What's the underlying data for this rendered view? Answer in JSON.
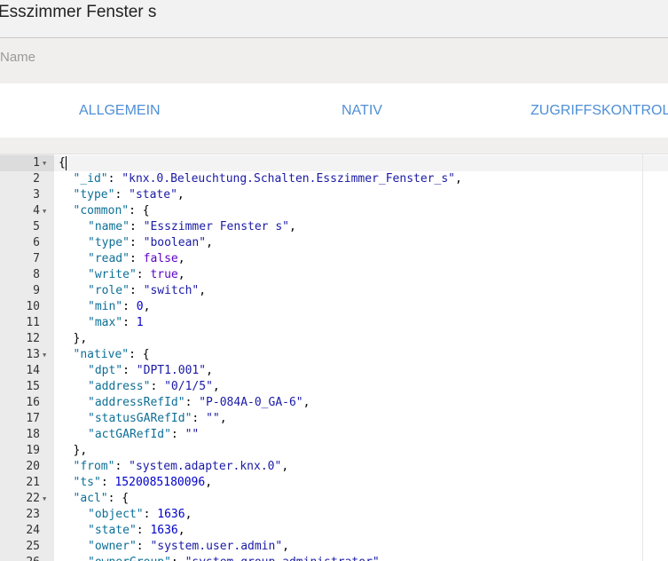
{
  "object_title": "Esszimmer Fenster s",
  "name_label": "Name",
  "tabs": [
    "ALLGEMEIN",
    "NATIV",
    "ZUGRIFFSKONTROLLE"
  ],
  "editor": {
    "lines": [
      {
        "no": "1",
        "fold": true,
        "indent": 0,
        "tokens": [
          [
            "p",
            "{"
          ]
        ]
      },
      {
        "no": "2",
        "fold": false,
        "indent": 1,
        "tokens": [
          [
            "k",
            "\"_id\""
          ],
          [
            "p",
            ": "
          ],
          [
            "s",
            "\"knx.0.Beleuchtung.Schalten.Esszimmer_Fenster_s\""
          ],
          [
            "p",
            ","
          ]
        ]
      },
      {
        "no": "3",
        "fold": false,
        "indent": 1,
        "tokens": [
          [
            "k",
            "\"type\""
          ],
          [
            "p",
            ": "
          ],
          [
            "s",
            "\"state\""
          ],
          [
            "p",
            ","
          ]
        ]
      },
      {
        "no": "4",
        "fold": true,
        "indent": 1,
        "tokens": [
          [
            "k",
            "\"common\""
          ],
          [
            "p",
            ": {"
          ]
        ]
      },
      {
        "no": "5",
        "fold": false,
        "indent": 2,
        "tokens": [
          [
            "k",
            "\"name\""
          ],
          [
            "p",
            ": "
          ],
          [
            "s",
            "\"Esszimmer Fenster s\""
          ],
          [
            "p",
            ","
          ]
        ]
      },
      {
        "no": "6",
        "fold": false,
        "indent": 2,
        "tokens": [
          [
            "k",
            "\"type\""
          ],
          [
            "p",
            ": "
          ],
          [
            "s",
            "\"boolean\""
          ],
          [
            "p",
            ","
          ]
        ]
      },
      {
        "no": "7",
        "fold": false,
        "indent": 2,
        "tokens": [
          [
            "k",
            "\"read\""
          ],
          [
            "p",
            ": "
          ],
          [
            "b",
            "false"
          ],
          [
            "p",
            ","
          ]
        ]
      },
      {
        "no": "8",
        "fold": false,
        "indent": 2,
        "tokens": [
          [
            "k",
            "\"write\""
          ],
          [
            "p",
            ": "
          ],
          [
            "b",
            "true"
          ],
          [
            "p",
            ","
          ]
        ]
      },
      {
        "no": "9",
        "fold": false,
        "indent": 2,
        "tokens": [
          [
            "k",
            "\"role\""
          ],
          [
            "p",
            ": "
          ],
          [
            "s",
            "\"switch\""
          ],
          [
            "p",
            ","
          ]
        ]
      },
      {
        "no": "10",
        "fold": false,
        "indent": 2,
        "tokens": [
          [
            "k",
            "\"min\""
          ],
          [
            "p",
            ": "
          ],
          [
            "n",
            "0"
          ],
          [
            "p",
            ","
          ]
        ]
      },
      {
        "no": "11",
        "fold": false,
        "indent": 2,
        "tokens": [
          [
            "k",
            "\"max\""
          ],
          [
            "p",
            ": "
          ],
          [
            "n",
            "1"
          ]
        ]
      },
      {
        "no": "12",
        "fold": false,
        "indent": 1,
        "tokens": [
          [
            "p",
            "},"
          ]
        ]
      },
      {
        "no": "13",
        "fold": true,
        "indent": 1,
        "tokens": [
          [
            "k",
            "\"native\""
          ],
          [
            "p",
            ": {"
          ]
        ]
      },
      {
        "no": "14",
        "fold": false,
        "indent": 2,
        "tokens": [
          [
            "k",
            "\"dpt\""
          ],
          [
            "p",
            ": "
          ],
          [
            "s",
            "\"DPT1.001\""
          ],
          [
            "p",
            ","
          ]
        ]
      },
      {
        "no": "15",
        "fold": false,
        "indent": 2,
        "tokens": [
          [
            "k",
            "\"address\""
          ],
          [
            "p",
            ": "
          ],
          [
            "s",
            "\"0/1/5\""
          ],
          [
            "p",
            ","
          ]
        ]
      },
      {
        "no": "16",
        "fold": false,
        "indent": 2,
        "tokens": [
          [
            "k",
            "\"addressRefId\""
          ],
          [
            "p",
            ": "
          ],
          [
            "s",
            "\"P-084A-0_GA-6\""
          ],
          [
            "p",
            ","
          ]
        ]
      },
      {
        "no": "17",
        "fold": false,
        "indent": 2,
        "tokens": [
          [
            "k",
            "\"statusGARefId\""
          ],
          [
            "p",
            ": "
          ],
          [
            "s",
            "\"\""
          ],
          [
            "p",
            ","
          ]
        ]
      },
      {
        "no": "18",
        "fold": false,
        "indent": 2,
        "tokens": [
          [
            "k",
            "\"actGARefId\""
          ],
          [
            "p",
            ": "
          ],
          [
            "s",
            "\"\""
          ]
        ]
      },
      {
        "no": "19",
        "fold": false,
        "indent": 1,
        "tokens": [
          [
            "p",
            "},"
          ]
        ]
      },
      {
        "no": "20",
        "fold": false,
        "indent": 1,
        "tokens": [
          [
            "k",
            "\"from\""
          ],
          [
            "p",
            ": "
          ],
          [
            "s",
            "\"system.adapter.knx.0\""
          ],
          [
            "p",
            ","
          ]
        ]
      },
      {
        "no": "21",
        "fold": false,
        "indent": 1,
        "tokens": [
          [
            "k",
            "\"ts\""
          ],
          [
            "p",
            ": "
          ],
          [
            "n",
            "1520085180096"
          ],
          [
            "p",
            ","
          ]
        ]
      },
      {
        "no": "22",
        "fold": true,
        "indent": 1,
        "tokens": [
          [
            "k",
            "\"acl\""
          ],
          [
            "p",
            ": {"
          ]
        ]
      },
      {
        "no": "23",
        "fold": false,
        "indent": 2,
        "tokens": [
          [
            "k",
            "\"object\""
          ],
          [
            "p",
            ": "
          ],
          [
            "n",
            "1636"
          ],
          [
            "p",
            ","
          ]
        ]
      },
      {
        "no": "24",
        "fold": false,
        "indent": 2,
        "tokens": [
          [
            "k",
            "\"state\""
          ],
          [
            "p",
            ": "
          ],
          [
            "n",
            "1636"
          ],
          [
            "p",
            ","
          ]
        ]
      },
      {
        "no": "25",
        "fold": false,
        "indent": 2,
        "tokens": [
          [
            "k",
            "\"owner\""
          ],
          [
            "p",
            ": "
          ],
          [
            "s",
            "\"system.user.admin\""
          ],
          [
            "p",
            ","
          ]
        ]
      },
      {
        "no": "26",
        "fold": false,
        "indent": 2,
        "tokens": [
          [
            "k",
            "\"ownerGroup\""
          ],
          [
            "p",
            ": "
          ],
          [
            "s",
            "\"system.group.administrator\""
          ]
        ]
      }
    ]
  }
}
